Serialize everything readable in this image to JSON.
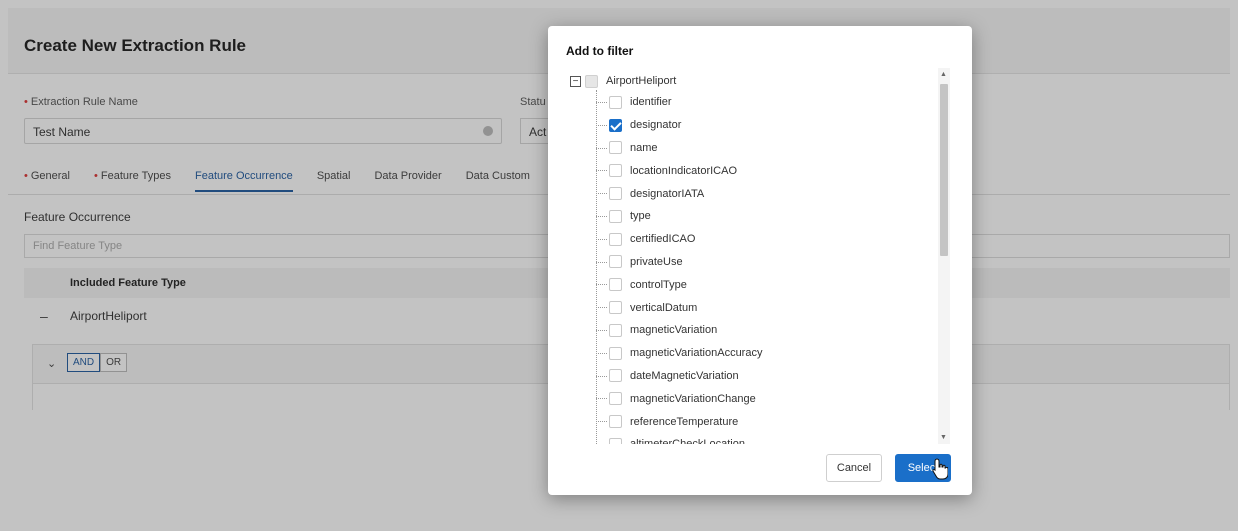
{
  "page": {
    "title": "Create New Extraction Rule",
    "name_label": "Extraction Rule Name",
    "name_value": "Test Name",
    "status_label": "Statu",
    "status_value": "Act",
    "tabs": [
      "General",
      "Feature Types",
      "Feature Occurrence",
      "Spatial",
      "Data Provider",
      "Data Custom"
    ],
    "active_tab": "Feature Occurrence",
    "section_label": "Feature Occurrence",
    "find_placeholder": "Find Feature Type",
    "table_header": "Included Feature Type",
    "row_minus": "–",
    "row_label": "AirportHeliport",
    "logic": {
      "and": "AND",
      "or": "OR"
    }
  },
  "dialog": {
    "title": "Add to filter",
    "root": {
      "label": "AirportHeliport",
      "toggle": "−"
    },
    "items": [
      {
        "label": "identifier",
        "checked": false
      },
      {
        "label": "designator",
        "checked": true
      },
      {
        "label": "name",
        "checked": false
      },
      {
        "label": "locationIndicatorICAO",
        "checked": false
      },
      {
        "label": "designatorIATA",
        "checked": false
      },
      {
        "label": "type",
        "checked": false
      },
      {
        "label": "certifiedICAO",
        "checked": false
      },
      {
        "label": "privateUse",
        "checked": false
      },
      {
        "label": "controlType",
        "checked": false
      },
      {
        "label": "verticalDatum",
        "checked": false
      },
      {
        "label": "magneticVariation",
        "checked": false
      },
      {
        "label": "magneticVariationAccuracy",
        "checked": false
      },
      {
        "label": "dateMagneticVariation",
        "checked": false
      },
      {
        "label": "magneticVariationChange",
        "checked": false
      },
      {
        "label": "referenceTemperature",
        "checked": false
      },
      {
        "label": "altimeterCheckLocation",
        "checked": false
      }
    ],
    "cancel_label": "Cancel",
    "select_label": "Select"
  },
  "colors": {
    "accent": "#1a6fc9",
    "required": "#d33333"
  }
}
